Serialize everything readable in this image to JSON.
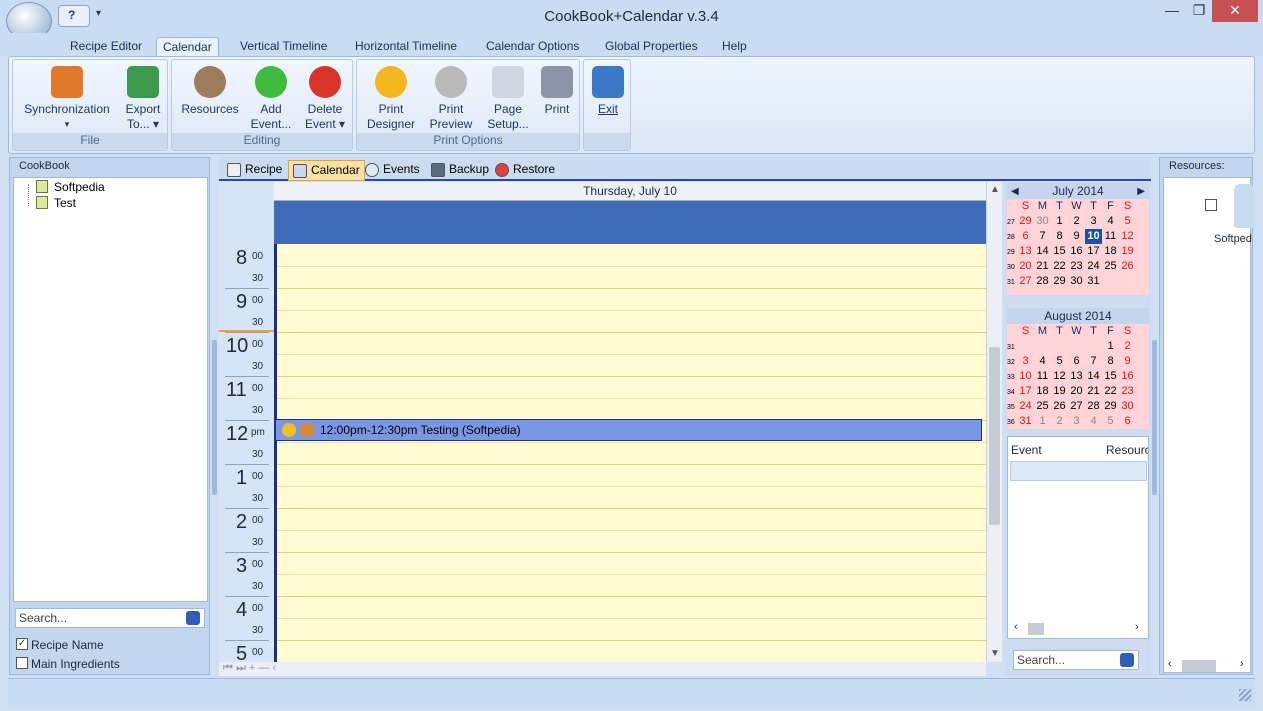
{
  "window": {
    "title": "CookBook+Calendar v.3.4",
    "help_symbol": "?",
    "qat_arrow": "▾",
    "min": "—",
    "restore": "❐",
    "close": "✕"
  },
  "tabs": [
    "Recipe Editor",
    "Calendar",
    "Vertical Timeline",
    "Horizontal Timeline",
    "Calendar Options",
    "Global Properties",
    "Help"
  ],
  "ribbon": {
    "groups": [
      {
        "label": "File",
        "buttons": [
          {
            "l1": "Synchronization",
            "l2": "▾",
            "icon": "sync-icon",
            "color": "#e07a2a"
          },
          {
            "l1": "Export",
            "l2": "To... ▾",
            "icon": "export-icon",
            "color": "#3c9a4c"
          }
        ]
      },
      {
        "label": "Editing",
        "buttons": [
          {
            "l1": "Resources",
            "l2": "",
            "icon": "people-icon",
            "color": "#9c7c5c"
          },
          {
            "l1": "Add",
            "l2": "Event...",
            "icon": "add-icon",
            "color": "#3fbb3f"
          },
          {
            "l1": "Delete",
            "l2": "Event ▾",
            "icon": "delete-icon",
            "color": "#d9342a"
          }
        ]
      },
      {
        "label": "Print Options",
        "buttons": [
          {
            "l1": "Print",
            "l2": "Designer",
            "icon": "gear-icon",
            "color": "#f2b61e"
          },
          {
            "l1": "Print",
            "l2": "Preview",
            "icon": "magnifier-icon",
            "color": "#b9b9b9"
          },
          {
            "l1": "Page",
            "l2": "Setup...",
            "icon": "page-icon",
            "color": "#cfd6e0"
          },
          {
            "l1": "Print",
            "l2": "",
            "icon": "printer-icon",
            "color": "#8a96a8"
          }
        ]
      },
      {
        "label": "",
        "buttons": [
          {
            "l1": "Exit",
            "l2": "",
            "icon": "exit-icon",
            "color": "#3a78c8"
          }
        ]
      }
    ]
  },
  "left": {
    "header": "CookBook",
    "items": [
      "Softpedia",
      "Test"
    ],
    "search_placeholder": "Search...",
    "opt1": "Recipe Name",
    "opt2": "Main Ingredients",
    "check_mark": "✓"
  },
  "center": {
    "tabs": [
      "Recipe",
      "Calendar",
      "Events",
      "Backup",
      "Restore"
    ],
    "date": "Thursday, July 10",
    "hours": [
      {
        "h": "8",
        "m": "00"
      },
      {
        "h": "9",
        "m": "00"
      },
      {
        "h": "10",
        "m": "00"
      },
      {
        "h": "11",
        "m": "00"
      },
      {
        "h": "12",
        "m": "pm"
      },
      {
        "h": "1",
        "m": "00"
      },
      {
        "h": "2",
        "m": "00"
      },
      {
        "h": "3",
        "m": "00"
      },
      {
        "h": "4",
        "m": "00"
      },
      {
        "h": "5",
        "m": "00"
      }
    ],
    "half": "30",
    "event": "12:00pm-12:30pm Testing (Softpedia)",
    "scroll_glyphs": "⏮  ⏭  +  —  ‹"
  },
  "calendar": {
    "july": {
      "title": "July 2014",
      "dow": [
        "S",
        "M",
        "T",
        "W",
        "T",
        "F",
        "S"
      ],
      "weeks": [
        {
          "n": "27",
          "d": [
            "29",
            "30",
            "1",
            "2",
            "3",
            "4",
            "5"
          ]
        },
        {
          "n": "28",
          "d": [
            "6",
            "7",
            "8",
            "9",
            "10",
            "11",
            "12"
          ]
        },
        {
          "n": "29",
          "d": [
            "13",
            "14",
            "15",
            "16",
            "17",
            "18",
            "19"
          ]
        },
        {
          "n": "30",
          "d": [
            "20",
            "21",
            "22",
            "23",
            "24",
            "25",
            "26"
          ]
        },
        {
          "n": "31",
          "d": [
            "27",
            "28",
            "29",
            "30",
            "31",
            "",
            ""
          ]
        }
      ]
    },
    "august": {
      "title": "August 2014",
      "dow": [
        "S",
        "M",
        "T",
        "W",
        "T",
        "F",
        "S"
      ],
      "weeks": [
        {
          "n": "31",
          "d": [
            "",
            "",
            "",
            "",
            "",
            "1",
            "2"
          ]
        },
        {
          "n": "32",
          "d": [
            "3",
            "4",
            "5",
            "6",
            "7",
            "8",
            "9"
          ]
        },
        {
          "n": "33",
          "d": [
            "10",
            "11",
            "12",
            "13",
            "14",
            "15",
            "16"
          ]
        },
        {
          "n": "34",
          "d": [
            "17",
            "18",
            "19",
            "20",
            "21",
            "22",
            "23"
          ]
        },
        {
          "n": "35",
          "d": [
            "24",
            "25",
            "26",
            "27",
            "28",
            "29",
            "30"
          ]
        },
        {
          "n": "36",
          "d": [
            "31",
            "1",
            "2",
            "3",
            "4",
            "5",
            "6"
          ]
        }
      ]
    },
    "prev": "◀",
    "next": "▶",
    "col_event": "Event",
    "col_resource": "Resource",
    "search_placeholder": "Search..."
  },
  "right": {
    "header": "Resources:",
    "resource": "Softped"
  }
}
